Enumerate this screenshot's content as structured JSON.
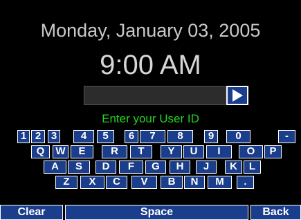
{
  "clock": {
    "date": "Monday, January 03, 2005",
    "time": "9:00 AM"
  },
  "login": {
    "user_id_value": "",
    "submit_icon": "play-arrow-icon",
    "prompt": "Enter your User ID"
  },
  "keyboard": {
    "row1": [
      "1",
      "2",
      "3",
      "4",
      "5",
      "6",
      "7",
      "8",
      "9",
      "0",
      "-"
    ],
    "row2": [
      "Q",
      "W",
      "E",
      "R",
      "T",
      "Y",
      "U",
      "I",
      "O",
      "P"
    ],
    "row3": [
      "A",
      "S",
      "D",
      "F",
      "G",
      "H",
      "J",
      "K",
      "L"
    ],
    "row4": [
      "Z",
      "X",
      "C",
      "V",
      "B",
      "N",
      "M",
      "."
    ],
    "clear_label": "Clear",
    "space_label": "Space",
    "back_label": "Back"
  },
  "colors": {
    "background": "#000000",
    "key_fill": "#1a3d8c",
    "key_border": "#ffffff",
    "prompt_text": "#22d422",
    "clock_text": "#c9c9c9"
  }
}
